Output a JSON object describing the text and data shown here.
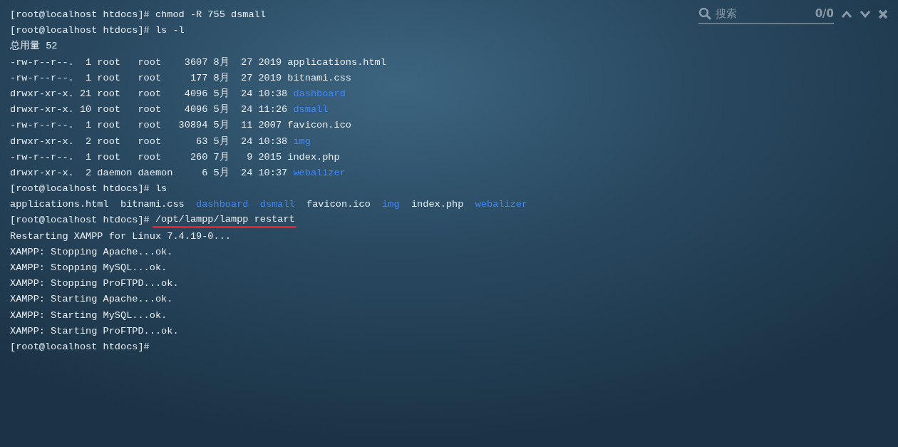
{
  "search": {
    "placeholder": "搜索",
    "count": "0/0"
  },
  "lines": [
    {
      "segments": [
        {
          "text": "[root@localhost htdocs]# chmod -R 755 dsmall",
          "kind": "plain"
        }
      ]
    },
    {
      "segments": [
        {
          "text": "[root@localhost htdocs]# ls -l",
          "kind": "plain"
        }
      ]
    },
    {
      "segments": [
        {
          "text": "总用量 52",
          "kind": "plain"
        }
      ]
    },
    {
      "segments": [
        {
          "text": "-rw-r--r--.  1 root   root    3607 8月  27 2019 applications.html",
          "kind": "plain"
        }
      ]
    },
    {
      "segments": [
        {
          "text": "-rw-r--r--.  1 root   root     177 8月  27 2019 bitnami.css",
          "kind": "plain"
        }
      ]
    },
    {
      "segments": [
        {
          "text": "drwxr-xr-x. 21 root   root    4096 5月  24 10:38 ",
          "kind": "plain"
        },
        {
          "text": "dashboard",
          "kind": "dir"
        }
      ]
    },
    {
      "segments": [
        {
          "text": "drwxr-xr-x. 10 root   root    4096 5月  24 11:26 ",
          "kind": "plain"
        },
        {
          "text": "dsmall",
          "kind": "dir"
        }
      ]
    },
    {
      "segments": [
        {
          "text": "-rw-r--r--.  1 root   root   30894 5月  11 2007 favicon.ico",
          "kind": "plain"
        }
      ]
    },
    {
      "segments": [
        {
          "text": "drwxr-xr-x.  2 root   root      63 5月  24 10:38 ",
          "kind": "plain"
        },
        {
          "text": "img",
          "kind": "dir"
        }
      ]
    },
    {
      "segments": [
        {
          "text": "-rw-r--r--.  1 root   root     260 7月   9 2015 index.php",
          "kind": "plain"
        }
      ]
    },
    {
      "segments": [
        {
          "text": "drwxr-xr-x.  2 daemon daemon     6 5月  24 10:37 ",
          "kind": "plain"
        },
        {
          "text": "webalizer",
          "kind": "dir"
        }
      ]
    },
    {
      "segments": [
        {
          "text": "[root@localhost htdocs]# ls",
          "kind": "plain"
        }
      ]
    },
    {
      "segments": [
        {
          "text": "applications.html  bitnami.css  ",
          "kind": "plain"
        },
        {
          "text": "dashboard",
          "kind": "dir"
        },
        {
          "text": "dsmall",
          "kind": "dir"
        },
        {
          "text": "  favicon.ico  ",
          "kind": "plain"
        },
        {
          "text": "img",
          "kind": "dir"
        },
        {
          "text": "  index.php  ",
          "kind": "plain"
        },
        {
          "text": "webalizer",
          "kind": "dir"
        }
      ]
    },
    {
      "segments": [
        {
          "text": "[root@localhost htdocs]# ",
          "kind": "plain"
        },
        {
          "text": "/opt/lampp/lampp restart",
          "kind": "marked"
        }
      ]
    },
    {
      "segments": [
        {
          "text": "Restarting XAMPP for Linux 7.4.19-0...",
          "kind": "plain"
        }
      ]
    },
    {
      "segments": [
        {
          "text": "XAMPP: Stopping Apache...ok.",
          "kind": "plain"
        }
      ]
    },
    {
      "segments": [
        {
          "text": "XAMPP: Stopping MySQL...ok.",
          "kind": "plain"
        }
      ]
    },
    {
      "segments": [
        {
          "text": "XAMPP: Stopping ProFTPD...ok.",
          "kind": "plain"
        }
      ]
    },
    {
      "segments": [
        {
          "text": "XAMPP: Starting Apache...ok.",
          "kind": "plain"
        }
      ]
    },
    {
      "segments": [
        {
          "text": "XAMPP: Starting MySQL...ok.",
          "kind": "plain"
        }
      ]
    },
    {
      "segments": [
        {
          "text": "XAMPP: Starting ProFTPD...ok.",
          "kind": "plain"
        }
      ]
    },
    {
      "segments": [
        {
          "text": "[root@localhost htdocs]#",
          "kind": "plain"
        }
      ]
    }
  ]
}
